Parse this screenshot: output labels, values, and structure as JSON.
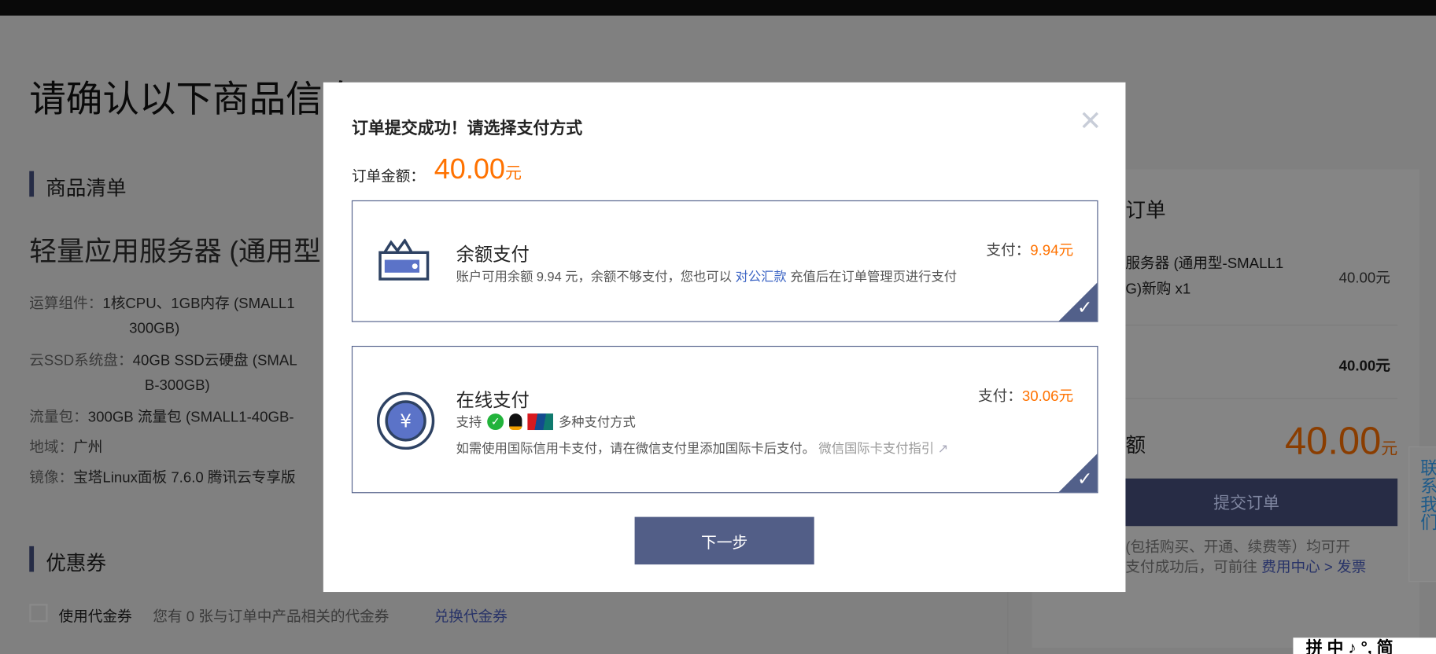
{
  "page": {
    "title": "请确认以下商品信息",
    "section_products": "商品清单",
    "product_title": "轻量应用服务器 (通用型",
    "specs": [
      {
        "label": "运算组件：",
        "value": "1核CPU、1GB内存 (SMALL1",
        "value2": "300GB)"
      },
      {
        "label": "云SSD系统盘：",
        "value": "40GB SSD云硬盘 (SMAL",
        "value2": "B-300GB)"
      },
      {
        "label": "流量包：",
        "value": "300GB 流量包 (SMALL1-40GB-"
      },
      {
        "label": "地域：",
        "value": "广州"
      },
      {
        "label": "镜像：",
        "value": "宝塔Linux面板 7.6.0 腾讯云专享版"
      }
    ],
    "section_coupon": "优惠券",
    "coupon_checkbox_label": "使用代金券",
    "coupon_info": "您有 0 张与订单中产品相关的代金券",
    "coupon_link": "兑换代金券"
  },
  "order_panel": {
    "title_fragment": "订单",
    "item_line1": "服务器 (通用型-SMALL1",
    "item_line2": "G)新购 x1",
    "item_price": "40.00元",
    "subtotal": "40.00元",
    "total_label_fragment": "额",
    "total_value": "40.00",
    "total_unit": "元",
    "submit_label": "提交订单",
    "note_line1": "(包括购买、开通、续费等）均可开",
    "note_line2": "支付成功后，可前往",
    "note_link": "费用中心 > 发票"
  },
  "contact_widget": {
    "label": "联系我们"
  },
  "ime_toolbar": {
    "label": "拼 中 ♪ °, 简"
  },
  "modal": {
    "title": "订单提交成功！请选择支付方式",
    "amount_label": "订单金额：",
    "amount_value": "40.00",
    "amount_unit": "元",
    "balance": {
      "name": "余额支付",
      "desc_before": "账户可用余额 9.94 元，余额不够支付，您也可以",
      "desc_link": "对公汇款",
      "desc_after": "充值后在订单管理页进行支付",
      "pay_label": "支付：",
      "pay_value": "9.94元",
      "selected": true
    },
    "online": {
      "name": "在线支付",
      "support_label": "支持",
      "support_after": "多种支付方式",
      "note": "如需使用国际信用卡支付，请在微信支付里添加国际卡后支付。",
      "note_link": "微信国际卡支付指引",
      "pay_label": "支付：",
      "pay_value": "30.06元",
      "selected": true
    },
    "next_label": "下一步"
  },
  "colors": {
    "accent": "#52608a",
    "price": "#ff7200",
    "link": "#3b64c4"
  }
}
